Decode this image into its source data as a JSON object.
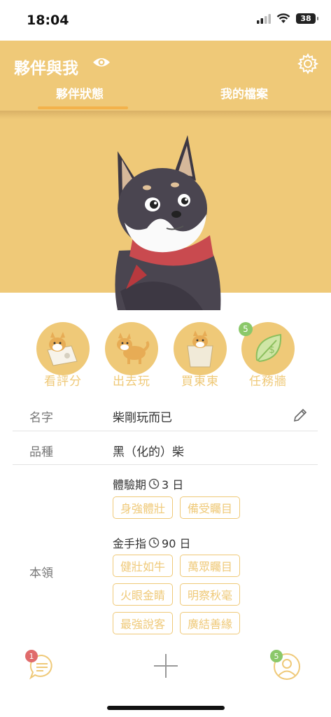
{
  "status": {
    "time": "18:04",
    "battery": "38"
  },
  "header": {
    "title": "夥伴與我",
    "tabs": [
      "夥伴狀態",
      "我的檔案"
    ]
  },
  "actions": [
    {
      "label": "看評分"
    },
    {
      "label": "出去玩"
    },
    {
      "label": "買東東"
    },
    {
      "label": "任務牆",
      "badge": "5"
    }
  ],
  "profile": {
    "name_label": "名字",
    "name_value": "柴剛玩而已",
    "breed_label": "品種",
    "breed_value": "黑（化的）柴",
    "skills_label": "本領",
    "trial_title": "體驗期",
    "trial_days": "3 日",
    "trial_tags": [
      "身強體壯",
      "備受矚目"
    ],
    "golden_title": "金手指",
    "golden_days": "90 日",
    "golden_tags": [
      "健壯如牛",
      "萬眾矚目",
      "火眼金睛",
      "明察秋毫",
      "最強說客",
      "廣結善緣"
    ]
  },
  "nav": {
    "chat_badge": "1",
    "profile_badge": "5"
  },
  "colors": {
    "accent": "#EFC978",
    "tab_indicator": "#F3B24B",
    "badge_green": "#8BC86A",
    "badge_red": "#E06B6B"
  }
}
